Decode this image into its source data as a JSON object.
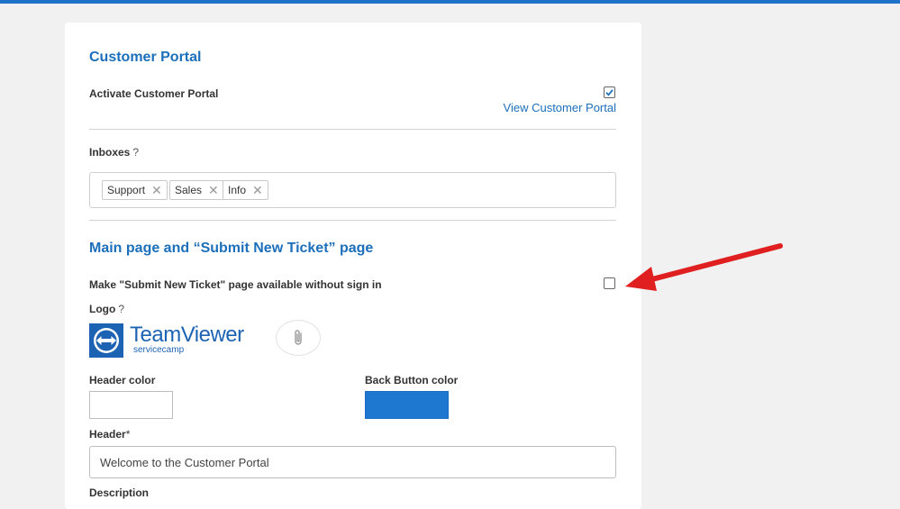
{
  "customer_portal": {
    "title": "Customer Portal",
    "activate_label": "Activate Customer Portal",
    "activate_checked": true,
    "view_link": "View Customer Portal"
  },
  "inboxes": {
    "label": "Inboxes",
    "help": "?",
    "items": [
      {
        "label": "Support",
        "remove": "✕"
      },
      {
        "label": "Sales",
        "remove": "✕"
      },
      {
        "label": "Info",
        "remove": "✕"
      }
    ]
  },
  "main_page": {
    "title": "Main page and “Submit New Ticket” page",
    "no_signin_label": "Make \"Submit New Ticket\" page available without sign in",
    "no_signin_checked": false,
    "logo_label": "Logo",
    "logo_help": "?",
    "logo_brand": "TeamViewer",
    "logo_sub": "servicecamp",
    "header_color_label": "Header color",
    "header_color": "#ffffff",
    "back_button_color_label": "Back Button color",
    "back_button_color": "#1e78d0",
    "header_label": "Header",
    "header_required": "*",
    "header_value": "Welcome to the Customer Portal",
    "description_label": "Description"
  },
  "colors": {
    "accent": "#1c6fba",
    "topbar": "#1e73c8",
    "annotation_arrow": "#e02020"
  }
}
